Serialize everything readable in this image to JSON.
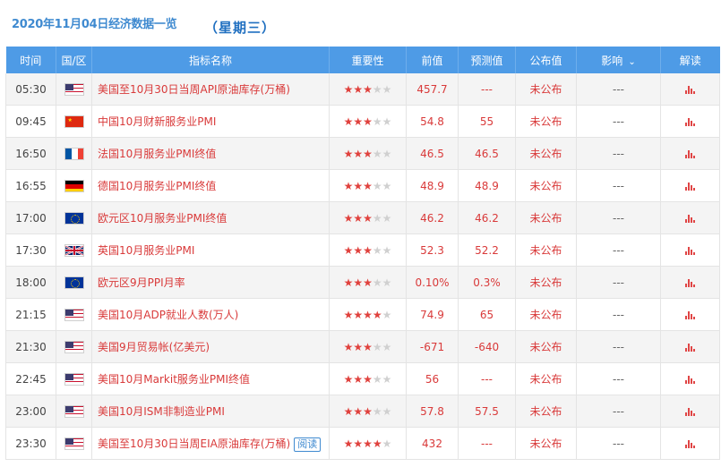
{
  "header": {
    "date_title": "2020年11月04日经济数据一览",
    "weekday": "（星期三）"
  },
  "columns": {
    "time": "时间",
    "country": "国/区",
    "indicator": "指标名称",
    "importance": "重要性",
    "previous": "前值",
    "forecast": "预测值",
    "actual": "公布值",
    "impact": "影响",
    "analysis": "解读"
  },
  "rows": [
    {
      "time": "05:30",
      "flag": "US",
      "name": "美国至10月30日当周API原油库存(万桶)",
      "stars": 3,
      "previous": "457.7",
      "forecast": "---",
      "actual": "未公布",
      "impact": "---"
    },
    {
      "time": "09:45",
      "flag": "CN",
      "name": "中国10月财新服务业PMI",
      "stars": 3,
      "previous": "54.8",
      "forecast": "55",
      "actual": "未公布",
      "impact": "---"
    },
    {
      "time": "16:50",
      "flag": "FR",
      "name": "法国10月服务业PMI终值",
      "stars": 3,
      "previous": "46.5",
      "forecast": "46.5",
      "actual": "未公布",
      "impact": "---"
    },
    {
      "time": "16:55",
      "flag": "DE",
      "name": "德国10月服务业PMI终值",
      "stars": 3,
      "previous": "48.9",
      "forecast": "48.9",
      "actual": "未公布",
      "impact": "---"
    },
    {
      "time": "17:00",
      "flag": "EU",
      "name": "欧元区10月服务业PMI终值",
      "stars": 3,
      "previous": "46.2",
      "forecast": "46.2",
      "actual": "未公布",
      "impact": "---"
    },
    {
      "time": "17:30",
      "flag": "UK",
      "name": "英国10月服务业PMI",
      "stars": 3,
      "previous": "52.3",
      "forecast": "52.2",
      "actual": "未公布",
      "impact": "---"
    },
    {
      "time": "18:00",
      "flag": "EU",
      "name": "欧元区9月PPI月率",
      "stars": 3,
      "previous": "0.10%",
      "forecast": "0.3%",
      "actual": "未公布",
      "impact": "---"
    },
    {
      "time": "21:15",
      "flag": "US",
      "name": "美国10月ADP就业人数(万人)",
      "stars": 4,
      "previous": "74.9",
      "forecast": "65",
      "actual": "未公布",
      "impact": "---"
    },
    {
      "time": "21:30",
      "flag": "US",
      "name": "美国9月贸易帐(亿美元)",
      "stars": 3,
      "previous": "-671",
      "forecast": "-640",
      "actual": "未公布",
      "impact": "---"
    },
    {
      "time": "22:45",
      "flag": "US",
      "name": "美国10月Markit服务业PMI终值",
      "stars": 3,
      "previous": "56",
      "forecast": "---",
      "actual": "未公布",
      "impact": "---"
    },
    {
      "time": "23:00",
      "flag": "US",
      "name": "美国10月ISM非制造业PMI",
      "stars": 3,
      "previous": "57.8",
      "forecast": "57.5",
      "actual": "未公布",
      "impact": "---"
    },
    {
      "time": "23:30",
      "flag": "US",
      "name": "美国至10月30日当周EIA原油库存(万桶)",
      "stars": 4,
      "previous": "432",
      "forecast": "---",
      "actual": "未公布",
      "impact": "---",
      "tag": "阅读"
    }
  ],
  "icons": {
    "impact_dropdown": "chevron-down-icon",
    "analysis": "bar-chart-icon",
    "importance": "star-icon"
  },
  "colors": {
    "header_bg": "#4e9be6",
    "accent_red": "#d93a3a",
    "title_blue": "#3f8ad0"
  }
}
